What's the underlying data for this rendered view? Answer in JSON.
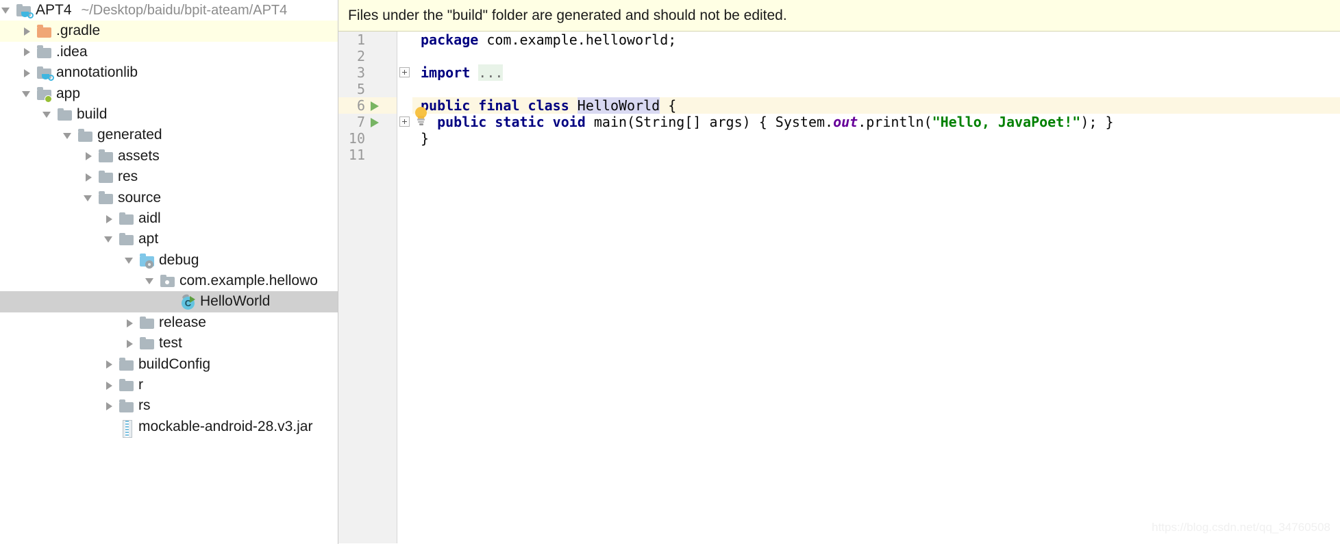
{
  "project_tree": {
    "root": {
      "label": "APT4",
      "path": "~/Desktop/baidu/bpit-ateam/APT4",
      "icon": "java-module-folder-icon",
      "state": "expanded"
    },
    "items": [
      {
        "label": ".gradle",
        "icon": "folder-orange-icon",
        "state": "collapsed",
        "indent": 1,
        "highlight": "excluded"
      },
      {
        "label": ".idea",
        "icon": "folder-icon",
        "state": "collapsed",
        "indent": 1,
        "highlight": "none"
      },
      {
        "label": "annotationlib",
        "icon": "java-module-folder-icon",
        "state": "collapsed",
        "indent": 1,
        "highlight": "none"
      },
      {
        "label": "app",
        "icon": "module-root-folder-icon",
        "state": "expanded",
        "indent": 1,
        "highlight": "none"
      },
      {
        "label": "build",
        "icon": "folder-icon",
        "state": "expanded",
        "indent": 2,
        "highlight": "none"
      },
      {
        "label": "generated",
        "icon": "folder-icon",
        "state": "expanded",
        "indent": 3,
        "highlight": "none"
      },
      {
        "label": "assets",
        "icon": "folder-icon",
        "state": "collapsed",
        "indent": 4,
        "highlight": "none"
      },
      {
        "label": "res",
        "icon": "folder-icon",
        "state": "collapsed",
        "indent": 4,
        "highlight": "none"
      },
      {
        "label": "source",
        "icon": "folder-icon",
        "state": "expanded",
        "indent": 4,
        "highlight": "none"
      },
      {
        "label": "aidl",
        "icon": "folder-icon",
        "state": "collapsed",
        "indent": 5,
        "highlight": "none"
      },
      {
        "label": "apt",
        "icon": "folder-icon",
        "state": "expanded",
        "indent": 5,
        "highlight": "none"
      },
      {
        "label": "debug",
        "icon": "generated-source-folder-icon",
        "state": "expanded",
        "indent": 6,
        "highlight": "none"
      },
      {
        "label": "com.example.hellowo",
        "icon": "package-icon",
        "state": "expanded",
        "indent": 7,
        "highlight": "none"
      },
      {
        "label": "HelloWorld",
        "icon": "java-class-icon",
        "state": "none",
        "indent": 8,
        "highlight": "selected"
      },
      {
        "label": "release",
        "icon": "folder-icon",
        "state": "collapsed",
        "indent": 6,
        "highlight": "none"
      },
      {
        "label": "test",
        "icon": "folder-icon",
        "state": "collapsed",
        "indent": 6,
        "highlight": "none"
      },
      {
        "label": "buildConfig",
        "icon": "folder-icon",
        "state": "collapsed",
        "indent": 5,
        "highlight": "none"
      },
      {
        "label": "r",
        "icon": "folder-icon",
        "state": "collapsed",
        "indent": 5,
        "highlight": "none"
      },
      {
        "label": "rs",
        "icon": "folder-icon",
        "state": "collapsed",
        "indent": 5,
        "highlight": "none"
      },
      {
        "label": "mockable-android-28.v3.jar",
        "icon": "jar-icon",
        "state": "none",
        "indent": 5,
        "highlight": "none"
      }
    ]
  },
  "editor": {
    "notification": "Files under the \"build\" folder are generated and should not be edited.",
    "gutter_lines": [
      {
        "num": "1",
        "run": false,
        "fold": false,
        "current": false
      },
      {
        "num": "2",
        "run": false,
        "fold": false,
        "current": false
      },
      {
        "num": "3",
        "run": false,
        "fold": true,
        "current": false
      },
      {
        "num": "5",
        "run": false,
        "fold": false,
        "current": false
      },
      {
        "num": "6",
        "run": true,
        "fold": false,
        "current": true
      },
      {
        "num": "7",
        "run": true,
        "fold": true,
        "current": false
      },
      {
        "num": "10",
        "run": false,
        "fold": false,
        "current": false
      },
      {
        "num": "11",
        "run": false,
        "fold": false,
        "current": false
      }
    ],
    "code": {
      "l1_kw": "package",
      "l1_rest": " com.example.helloworld;",
      "l3_kw": "import",
      "l3_folded": "...",
      "l6_kw": "public final class ",
      "l6_ident": "HelloWorld",
      "l6_brace": " {",
      "l7_indent": "  ",
      "l7_kw": "public static void ",
      "l7_sig": "main(String[] args) { System.",
      "l7_static": "out",
      "l7_call": ".println(",
      "l7_string": "\"Hello, JavaPoet!\"",
      "l7_tail": "); }",
      "l10_brace": "}"
    },
    "intention_icon": "lightbulb-icon"
  },
  "watermark": "https://blog.csdn.net/qq_34760508",
  "colors": {
    "keyword": "#000080",
    "string": "#008000",
    "static_field": "#660099",
    "selection": "#d0d0d0",
    "excluded_row": "#ffffe4",
    "current_line": "#fdf7e2",
    "notification_bg": "#ffffe4"
  }
}
